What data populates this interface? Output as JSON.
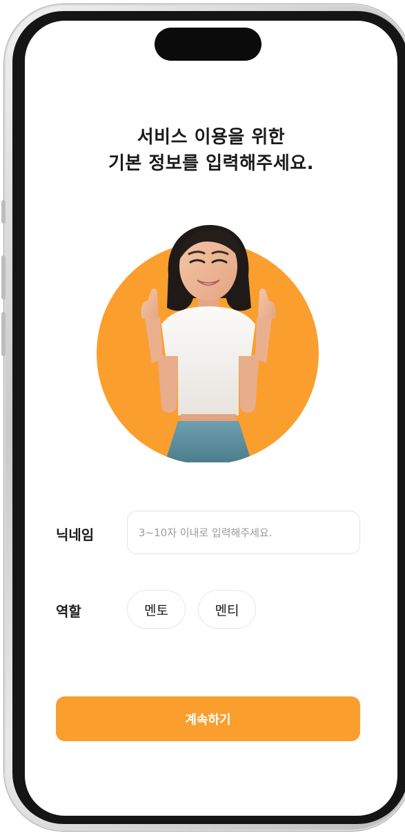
{
  "header": {
    "title_line1": "서비스 이용을 위한",
    "title_line2": "기본 정보를 입력해주세요."
  },
  "form": {
    "nickname_label": "닉네임",
    "nickname_placeholder": "3~10자 이내로 입력해주세요.",
    "nickname_value": "",
    "role_label": "역할",
    "role_options": [
      "멘토",
      "멘티"
    ]
  },
  "actions": {
    "continue_label": "계속하기"
  },
  "colors": {
    "accent": "#fa9f2e",
    "text": "#1a1a1a",
    "placeholder": "#9a9a9a",
    "border": "#e3e3e3"
  },
  "icons": {
    "illustration": "woman-fingers-crossed-avatar"
  }
}
